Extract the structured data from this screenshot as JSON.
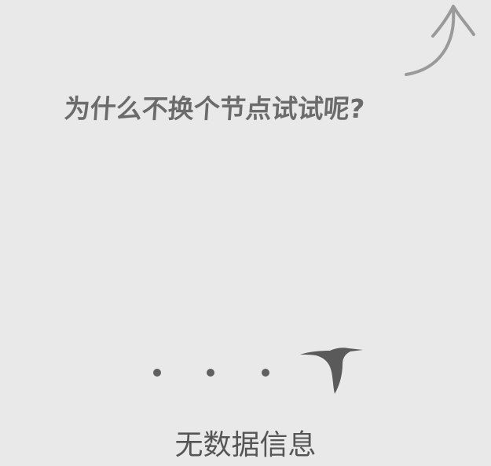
{
  "hint": {
    "text": "为什么不换个节点试试呢?"
  },
  "empty_state": {
    "label": "无数据信息"
  },
  "icons": {
    "arrow": "curved-arrow-up-icon",
    "bird": "bird-icon",
    "dots": "loading-dots-icon"
  },
  "colors": {
    "background": "#e9e9e9",
    "arrow": "#9a9a9a",
    "hint_text": "#6b6b6b",
    "dots": "#606060",
    "bird": "#5a5a5a",
    "label": "#555555"
  }
}
